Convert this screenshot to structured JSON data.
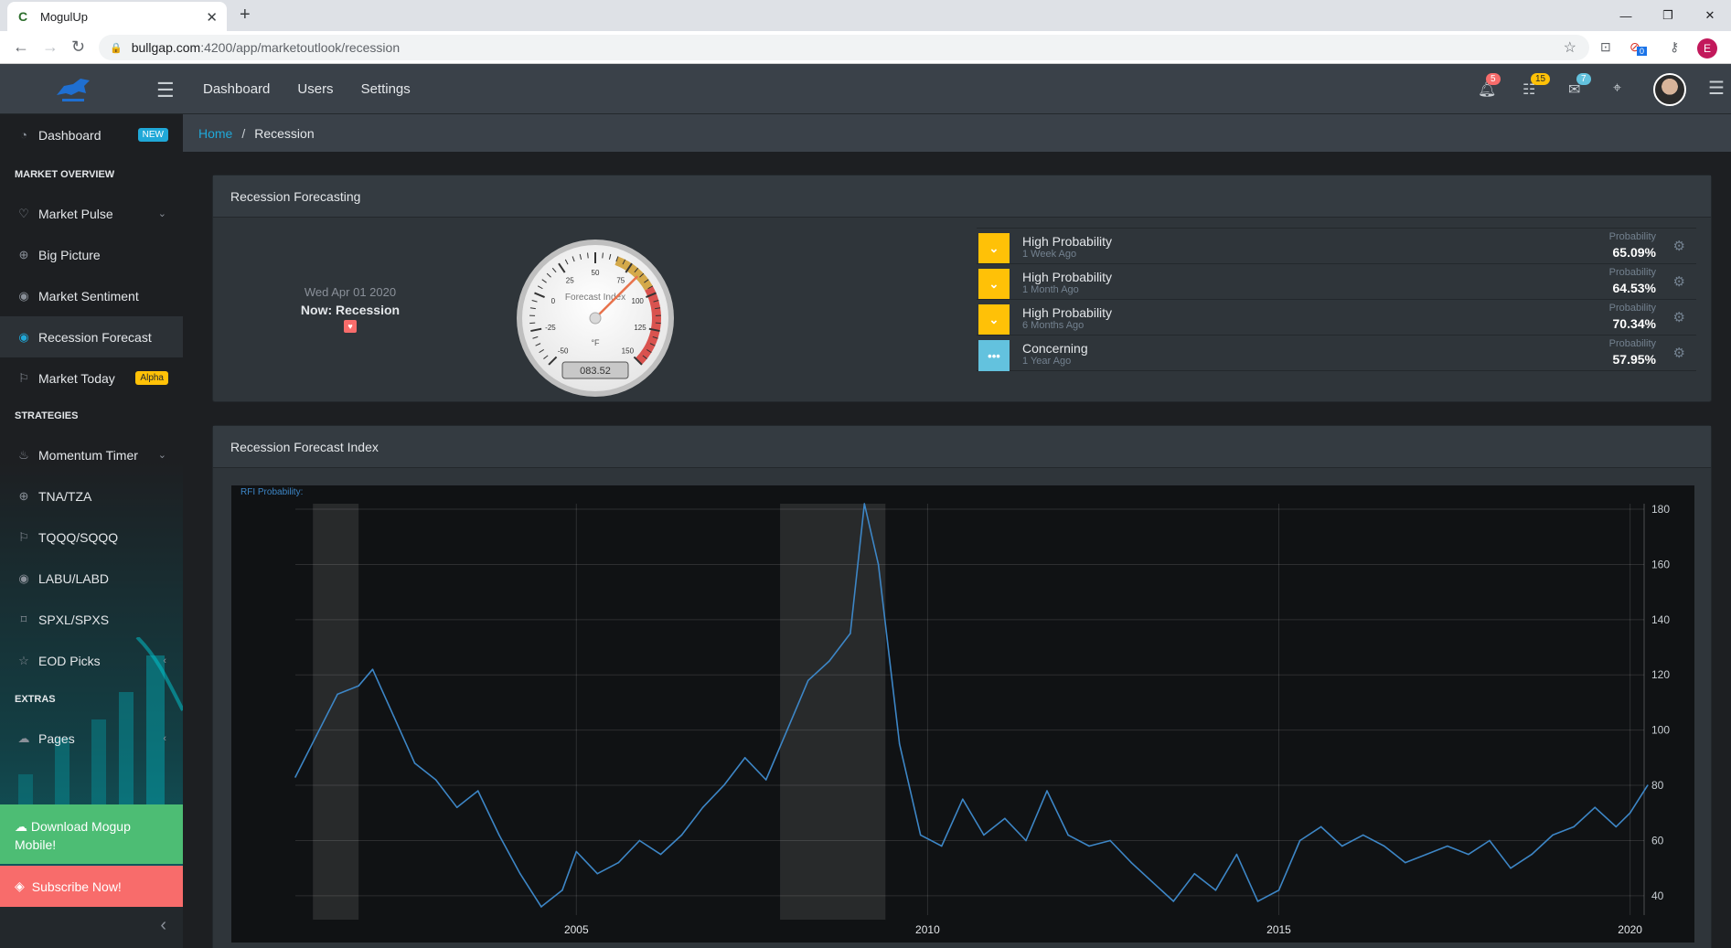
{
  "browser": {
    "tab_title": "MogulUp",
    "url_host": "bullgap.com",
    "url_path": ":4200/app/marketoutlook/recession",
    "ext_badge": "0",
    "profile_initial": "E"
  },
  "header": {
    "nav": [
      "Dashboard",
      "Users",
      "Settings"
    ],
    "badges": {
      "bell": "5",
      "list": "15",
      "mail": "7"
    }
  },
  "sidebar": {
    "dashboard": "Dashboard",
    "dashboard_badge": "NEW",
    "section_market": "MARKET OVERVIEW",
    "market_pulse": "Market Pulse",
    "big_picture": "Big Picture",
    "market_sentiment": "Market Sentiment",
    "recession_forecast": "Recession Forecast",
    "market_today": "Market Today",
    "market_today_badge": "Alpha",
    "section_strategies": "STRATEGIES",
    "momentum_timer": "Momentum Timer",
    "tna": "TNA/TZA",
    "tqqq": "TQQQ/SQQQ",
    "labu": "LABU/LABD",
    "spxl": "SPXL/SPXS",
    "eod": "EOD Picks",
    "section_extras": "EXTRAS",
    "pages": "Pages",
    "download": "Download Mogup Mobile!",
    "subscribe": "Subscribe Now!"
  },
  "breadcrumb": {
    "home": "Home",
    "sep": "/",
    "current": "Recession"
  },
  "forecast_card": {
    "title": "Recession Forecasting",
    "date": "Wed Apr 01 2020",
    "now_label": "Now: Recession",
    "gauge": {
      "label": "Forecast Index",
      "unit": "°F",
      "readout": "083.52",
      "value": 83.52,
      "min": -50,
      "max": 150,
      "ticks": [
        "-50",
        "-25",
        "0",
        "25",
        "50",
        "75",
        "100",
        "125",
        "150"
      ]
    },
    "probabilities": [
      {
        "title": "High Probability",
        "ago": "1 Week Ago",
        "label": "Probability",
        "value": "65.09%",
        "kind": "down",
        "color": "#ffc107"
      },
      {
        "title": "High Probability",
        "ago": "1 Month Ago",
        "label": "Probability",
        "value": "64.53%",
        "kind": "down",
        "color": "#ffc107"
      },
      {
        "title": "High Probability",
        "ago": "6 Months Ago",
        "label": "Probability",
        "value": "70.34%",
        "kind": "down",
        "color": "#ffc107"
      },
      {
        "title": "Concerning",
        "ago": "1 Year Ago",
        "label": "Probability",
        "value": "57.95%",
        "kind": "dots",
        "color": "#63c2de"
      }
    ]
  },
  "index_card": {
    "title": "Recession Forecast Index",
    "legend": "RFI Probability:"
  },
  "chart_data": {
    "type": "line",
    "title": "",
    "series": [
      {
        "name": "RFI Probability:",
        "x": [
          2001.0,
          2001.3,
          2001.6,
          2001.9,
          2002.1,
          2002.4,
          2002.7,
          2003.0,
          2003.3,
          2003.6,
          2003.9,
          2004.2,
          2004.5,
          2004.8,
          2005.0,
          2005.3,
          2005.6,
          2005.9,
          2006.2,
          2006.5,
          2006.8,
          2007.1,
          2007.4,
          2007.7,
          2008.0,
          2008.3,
          2008.6,
          2008.9,
          2009.1,
          2009.3,
          2009.6,
          2009.9,
          2010.2,
          2010.5,
          2010.8,
          2011.1,
          2011.4,
          2011.7,
          2012.0,
          2012.3,
          2012.6,
          2012.9,
          2013.2,
          2013.5,
          2013.8,
          2014.1,
          2014.4,
          2014.7,
          2015.0,
          2015.3,
          2015.6,
          2015.9,
          2016.2,
          2016.5,
          2016.8,
          2017.1,
          2017.4,
          2017.7,
          2018.0,
          2018.3,
          2018.6,
          2018.9,
          2019.2,
          2019.5,
          2019.8,
          2020.0,
          2020.25
        ],
        "y": [
          83,
          98,
          113,
          116,
          122,
          105,
          88,
          82,
          72,
          78,
          62,
          48,
          36,
          42,
          56,
          48,
          52,
          60,
          55,
          62,
          72,
          80,
          90,
          82,
          100,
          118,
          125,
          135,
          182,
          160,
          95,
          62,
          58,
          75,
          62,
          68,
          60,
          78,
          62,
          58,
          60,
          52,
          45,
          38,
          48,
          42,
          55,
          38,
          42,
          60,
          65,
          58,
          62,
          58,
          52,
          55,
          58,
          55,
          60,
          50,
          55,
          62,
          65,
          72,
          65,
          70,
          80
        ]
      }
    ],
    "x_ticks": [
      "2005",
      "2010",
      "2015",
      "2020"
    ],
    "y_ticks": [
      "40",
      "60",
      "80",
      "100",
      "120",
      "140",
      "160",
      "180"
    ],
    "xlim": [
      2001.0,
      2020.2
    ],
    "ylim": [
      33,
      182
    ],
    "recession_bands": [
      [
        2001.25,
        2001.9
      ],
      [
        2007.9,
        2009.4
      ]
    ],
    "grid": true
  }
}
